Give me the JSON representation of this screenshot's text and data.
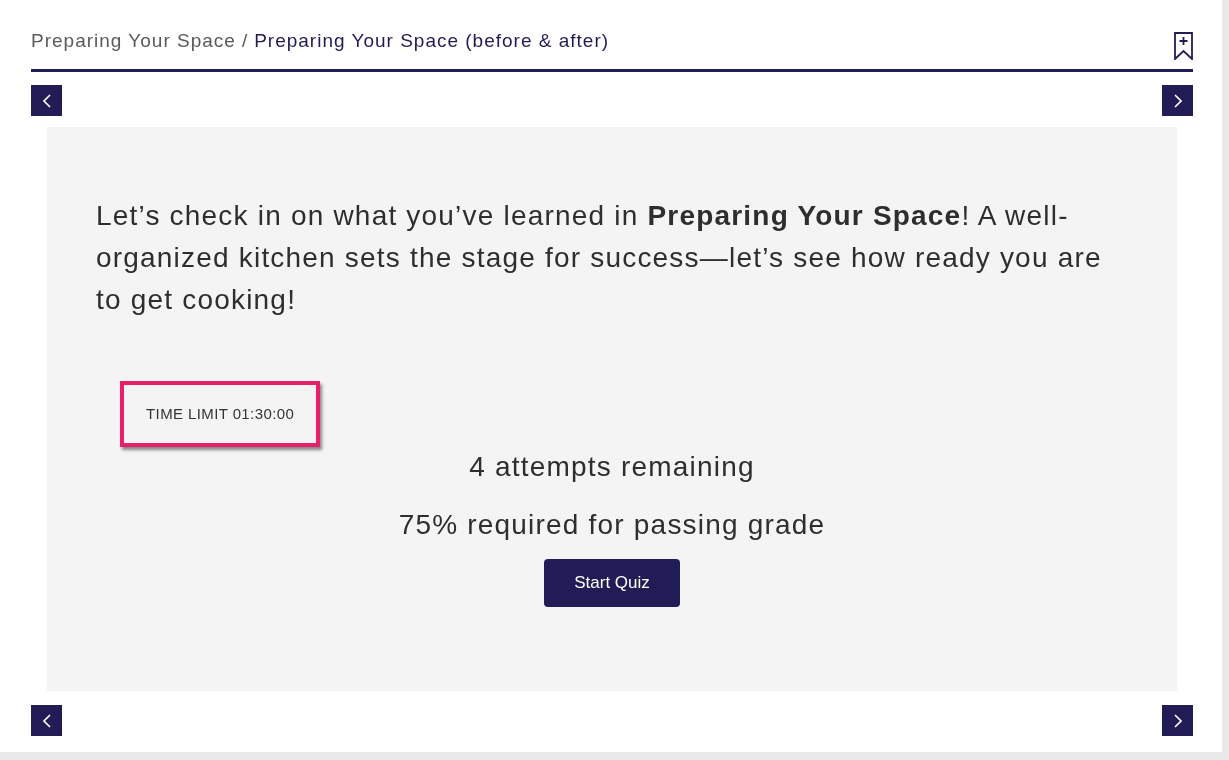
{
  "breadcrumb": {
    "parent": "Preparing Your Space",
    "separator": "/",
    "current": "Preparing Your Space (before & after)"
  },
  "quiz": {
    "intro": "Let’s check in on what you’ve learned in **Preparing Your Space**! A well-organized kitchen sets the stage for success—let’s see how ready you are to get cooking!",
    "time_limit": {
      "text": "TIME LIMIT 01:30:00",
      "highlighted": true
    },
    "attempts": "4 attempts remaining",
    "passing_grade": "75% required for passing grade",
    "start_button": "Start Quiz"
  }
}
